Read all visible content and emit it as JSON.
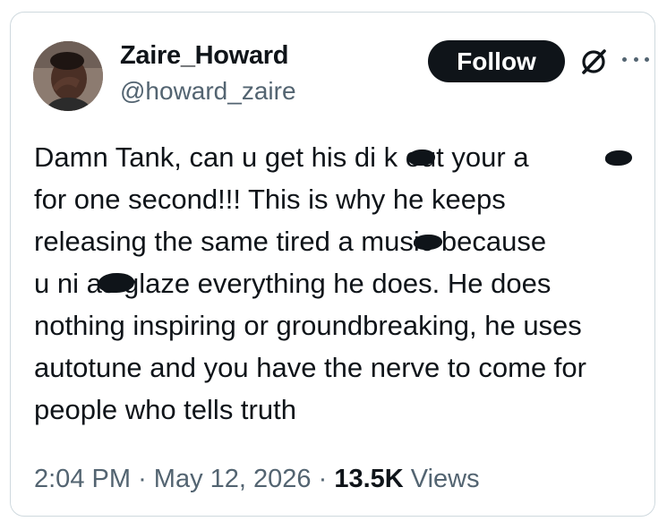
{
  "tweet": {
    "author": {
      "display_name": "Zaire_Howard",
      "handle": "@howard_zaire"
    },
    "follow_label": "Follow",
    "text_lines": [
      "Damn Tank, can u get his di  k out your a  ",
      "for one second!!! This is why he keeps",
      "releasing the same tired a   music because",
      "u ni   as glaze everything he does. He does",
      "nothing inspiring or groundbreaking, he uses",
      "autotune and you have the nerve to come for",
      "people who tells truth"
    ],
    "time": "2:04 PM",
    "separator": "·",
    "date": "May 12, 2026",
    "views_count": "13.5K",
    "views_label": "Views"
  },
  "icons": {
    "logo": "x-logo-icon",
    "more": "more-icon",
    "avatar": "avatar"
  },
  "colors": {
    "text": "#0f1419",
    "secondary": "#536471",
    "border": "#cfd9de",
    "button_bg": "#0f1419",
    "button_text": "#ffffff"
  }
}
